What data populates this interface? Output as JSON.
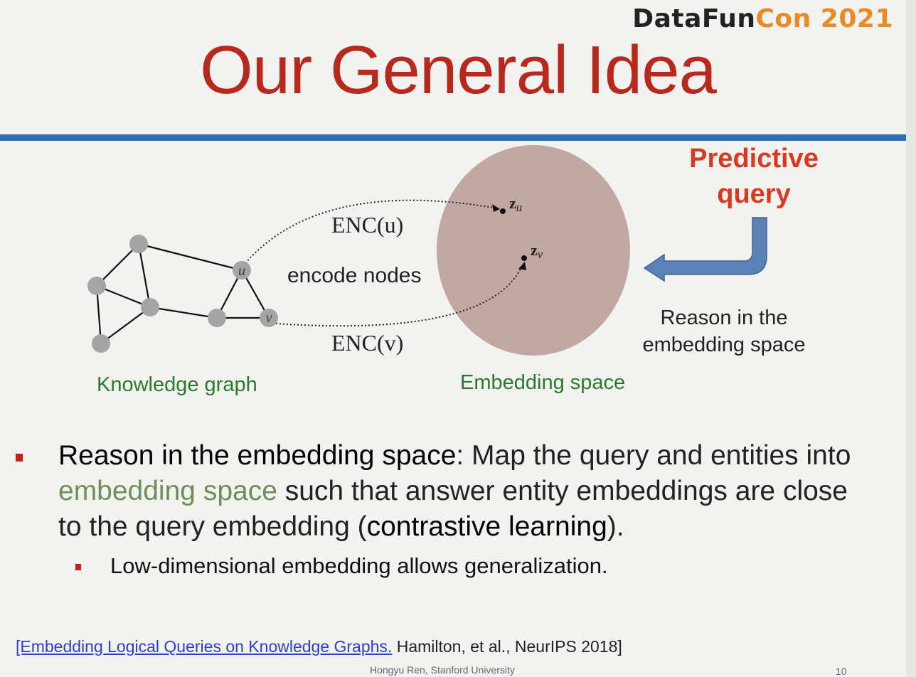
{
  "logo": {
    "main": "DataFun",
    "accent": "Con 2021"
  },
  "title": "Our General Idea",
  "diagram": {
    "node_u": "u",
    "node_v": "v",
    "enc_u": "ENC(u)",
    "enc_v": "ENC(v)",
    "encode_nodes": "encode nodes",
    "z_u": "z",
    "z_u_sub": "u",
    "z_v": "z",
    "z_v_sub": "v",
    "knowledge_graph_label": "Knowledge graph",
    "embedding_space_label": "Embedding space",
    "predictive_line1": "Predictive",
    "predictive_line2": "query",
    "reason_line1": "Reason in the",
    "reason_line2": "embedding space",
    "colors": {
      "embedding_blob": "#b89b94",
      "arrow": "#5b82b6",
      "title": "#b8281c",
      "predictive": "#d93a1e",
      "green_label": "#2b7a2b"
    }
  },
  "bullets": {
    "main_strong": "Reason in the embedding space",
    "main_part1": ": Map the query and entities into ",
    "main_soft": "embedding space",
    "main_part2": " such that answer entity embeddings are close to the query embedding (",
    "main_strong2": "contrastive learning",
    "main_part3": ").",
    "sub": "Low-dimensional embedding allows generalization."
  },
  "reference": {
    "link_text": "[Embedding Logical Queries on Knowledge Graphs.",
    "rest": " Hamilton, et al., NeurIPS 2018]"
  },
  "footer": "Hongyu Ren, Stanford University",
  "page_number": "10"
}
